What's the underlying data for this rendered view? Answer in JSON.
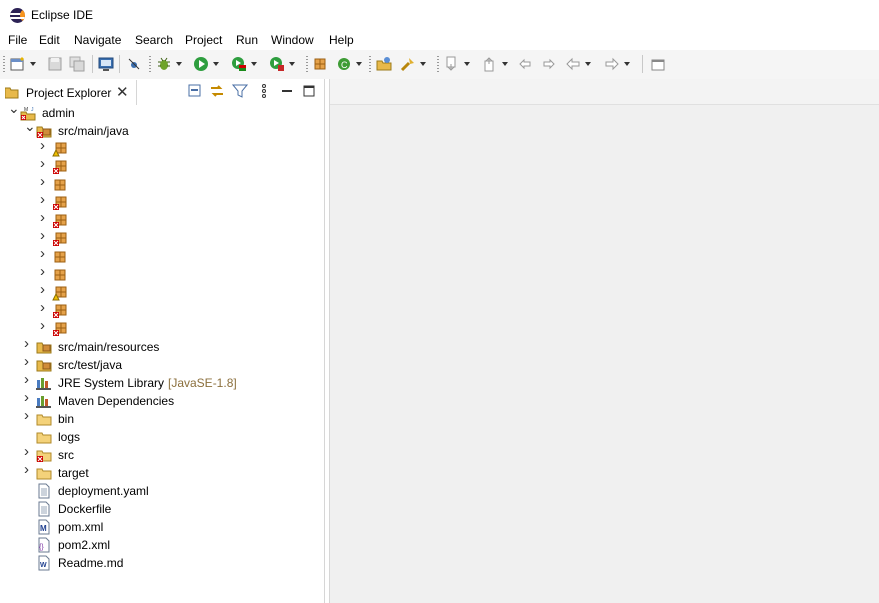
{
  "window": {
    "title": "Eclipse IDE"
  },
  "menu": [
    "File",
    "Edit",
    "Navigate",
    "Search",
    "Project",
    "Run",
    "Window",
    "Help"
  ],
  "toolbar": {
    "icons": [
      "new-icon",
      "save-icon",
      "save-all-icon",
      "terminal-icon",
      "skip-breakpoints-icon",
      "debug-icon",
      "run-icon",
      "coverage-icon",
      "external-tools-icon",
      "new-java-package-icon",
      "refresh-icon",
      "open-type-icon",
      "search-icon",
      "next-annotation-icon",
      "previous-annotation-icon",
      "last-edit-location-icon",
      "forward-history-icon",
      "back-icon",
      "forward-icon",
      "maximize-editor-icon"
    ]
  },
  "explorer": {
    "tab_label": "Project Explorer",
    "close_glyph": "✕",
    "project": "admin",
    "items": [
      {
        "label": "src/main/java",
        "level": 1,
        "expanded": true,
        "icon": "source-folder-error-icon"
      },
      {
        "label": "",
        "level": 2,
        "icon": "package-warning-icon"
      },
      {
        "label": "",
        "level": 2,
        "icon": "package-error-icon"
      },
      {
        "label": "",
        "level": 2,
        "icon": "package-icon"
      },
      {
        "label": "",
        "level": 2,
        "icon": "package-error-icon"
      },
      {
        "label": "",
        "level": 2,
        "icon": "package-error-icon"
      },
      {
        "label": "",
        "level": 2,
        "icon": "package-error-icon"
      },
      {
        "label": "",
        "level": 2,
        "icon": "package-icon"
      },
      {
        "label": "",
        "level": 2,
        "icon": "package-icon"
      },
      {
        "label": "",
        "level": 2,
        "icon": "package-warning-icon"
      },
      {
        "label": "",
        "level": 2,
        "icon": "package-error-icon"
      },
      {
        "label": "",
        "level": 2,
        "icon": "package-error-icon"
      },
      {
        "label": "src/main/resources",
        "level": 1,
        "icon": "source-folder-icon"
      },
      {
        "label": "src/test/java",
        "level": 1,
        "icon": "source-folder-icon"
      },
      {
        "label": "JRE System Library",
        "decoration": "[JavaSE-1.8]",
        "level": 1,
        "icon": "library-icon"
      },
      {
        "label": "Maven Dependencies",
        "level": 1,
        "icon": "library-icon"
      },
      {
        "label": "bin",
        "level": 1,
        "icon": "folder-icon"
      },
      {
        "label": "logs",
        "level": 1,
        "noarrow": true,
        "icon": "folder-icon"
      },
      {
        "label": "src",
        "level": 1,
        "icon": "folder-error-icon"
      },
      {
        "label": "target",
        "level": 1,
        "icon": "folder-icon"
      },
      {
        "label": "deployment.yaml",
        "level": 1,
        "noarrow": true,
        "icon": "file-icon"
      },
      {
        "label": "Dockerfile",
        "level": 1,
        "noarrow": true,
        "icon": "file-icon"
      },
      {
        "label": "pom.xml",
        "level": 1,
        "noarrow": true,
        "icon": "maven-pom-icon"
      },
      {
        "label": "pom2.xml",
        "level": 1,
        "noarrow": true,
        "icon": "xml-file-icon"
      },
      {
        "label": "Readme.md",
        "level": 1,
        "noarrow": true,
        "icon": "markdown-file-icon"
      }
    ]
  }
}
